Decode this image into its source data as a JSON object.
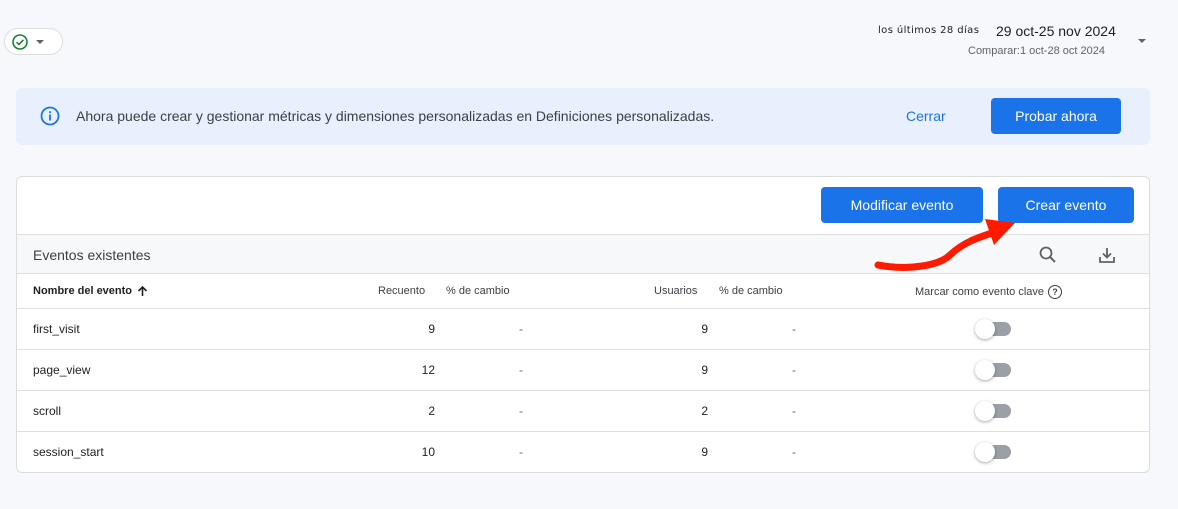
{
  "header": {
    "status_icon": "check-circle-icon",
    "date_label": "los últimos 28 días",
    "date_range": "29 oct-25 nov 2024",
    "compare_text": "Comparar:1 oct-28 oct 2024"
  },
  "banner": {
    "message": "Ahora puede crear y gestionar métricas y dimensiones personalizadas en Definiciones personalizadas.",
    "close_label": "Cerrar",
    "try_label": "Probar ahora"
  },
  "actions": {
    "modify_label": "Modificar evento",
    "create_label": "Crear evento"
  },
  "table": {
    "title": "Eventos existentes",
    "columns": {
      "name": "Nombre del evento",
      "count": "Recuento",
      "count_change": "% de cambio",
      "users": "Usuarios",
      "users_change": "% de cambio",
      "key_event": "Marcar como evento clave"
    },
    "rows": [
      {
        "name": "first_visit",
        "count": "9",
        "count_change": "-",
        "users": "9",
        "users_change": "-",
        "key_event": false
      },
      {
        "name": "page_view",
        "count": "12",
        "count_change": "-",
        "users": "9",
        "users_change": "-",
        "key_event": false
      },
      {
        "name": "scroll",
        "count": "2",
        "count_change": "-",
        "users": "2",
        "users_change": "-",
        "key_event": false
      },
      {
        "name": "session_start",
        "count": "10",
        "count_change": "-",
        "users": "9",
        "users_change": "-",
        "key_event": false
      }
    ]
  },
  "colors": {
    "accent": "#1a73e8",
    "banner_bg": "#e8f0fe",
    "annotation_arrow": "#ff1a00"
  }
}
